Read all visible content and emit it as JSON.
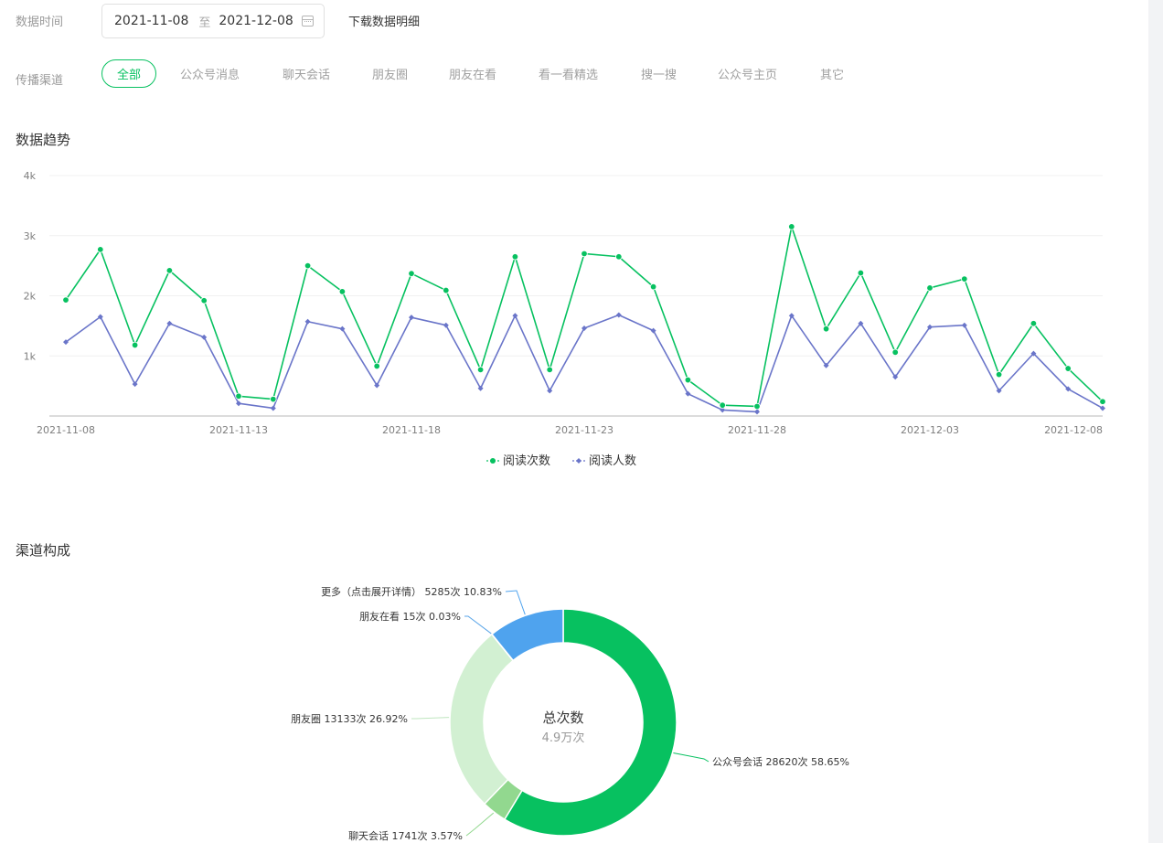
{
  "filters": {
    "date_label": "数据时间",
    "date_start": "2021-11-08",
    "date_sep": "至",
    "date_end": "2021-12-08",
    "download_label": "下载数据明细",
    "channel_label": "传播渠道",
    "channels": [
      "全部",
      "公众号消息",
      "聊天会话",
      "朋友圈",
      "朋友在看",
      "看一看精选",
      "搜一搜",
      "公众号主页",
      "其它"
    ],
    "active_channel": "全部"
  },
  "trend_title": "数据趋势",
  "composition_title": "渠道构成",
  "colors": {
    "accent": "#07c160",
    "series_reads": "#07c160",
    "series_readers": "#6a75c9",
    "pie_public_chat": "#07c160",
    "pie_chat": "#92d88f",
    "pie_moments": "#d2f0d2",
    "pie_looking": "#5aa5e8",
    "pie_more": "#4fa3ee"
  },
  "chart_data": [
    {
      "type": "line",
      "title": "",
      "xlabel": "",
      "ylabel": "",
      "ylim": [
        0,
        4000
      ],
      "yticks": [
        1000,
        2000,
        3000,
        4000
      ],
      "ytick_labels": [
        "1k",
        "2k",
        "3k",
        "4k"
      ],
      "x": [
        "2021-11-08",
        "2021-11-09",
        "2021-11-10",
        "2021-11-11",
        "2021-11-12",
        "2021-11-13",
        "2021-11-14",
        "2021-11-15",
        "2021-11-16",
        "2021-11-17",
        "2021-11-18",
        "2021-11-19",
        "2021-11-20",
        "2021-11-21",
        "2021-11-22",
        "2021-11-23",
        "2021-11-24",
        "2021-11-25",
        "2021-11-26",
        "2021-11-27",
        "2021-11-28",
        "2021-11-29",
        "2021-11-30",
        "2021-12-01",
        "2021-12-02",
        "2021-12-03",
        "2021-12-04",
        "2021-12-05",
        "2021-12-06",
        "2021-12-07",
        "2021-12-08"
      ],
      "xtick_labels": [
        "2021-11-08",
        "2021-11-13",
        "2021-11-18",
        "2021-11-23",
        "2021-11-28",
        "2021-12-03",
        "2021-12-08"
      ],
      "grid": true,
      "legend": "bottom-center",
      "series": [
        {
          "name": "阅读次数",
          "marker": "circle",
          "values": [
            1930,
            2770,
            1180,
            2420,
            1920,
            330,
            280,
            2500,
            2070,
            830,
            2370,
            2090,
            770,
            2650,
            770,
            2700,
            2650,
            2150,
            600,
            180,
            160,
            3150,
            1450,
            2380,
            1060,
            2130,
            2280,
            690,
            1540,
            790,
            240
          ]
        },
        {
          "name": "阅读人数",
          "marker": "diamond",
          "values": [
            1230,
            1650,
            530,
            1540,
            1310,
            210,
            130,
            1570,
            1450,
            510,
            1640,
            1510,
            460,
            1670,
            420,
            1460,
            1680,
            1420,
            370,
            100,
            70,
            1670,
            840,
            1540,
            650,
            1480,
            1510,
            420,
            1040,
            450,
            130
          ]
        }
      ]
    },
    {
      "type": "pie",
      "title": "",
      "center_title": "总次数",
      "center_value": "4.9万次",
      "slices": [
        {
          "name": "公众号会话",
          "count": 28620,
          "percent": 58.65,
          "label": "公众号会话 28620次 58.65%"
        },
        {
          "name": "聊天会话",
          "count": 1741,
          "percent": 3.57,
          "label": "聊天会话 1741次 3.57%"
        },
        {
          "name": "朋友圈",
          "count": 13133,
          "percent": 26.92,
          "label": "朋友圈 13133次 26.92%"
        },
        {
          "name": "朋友在看",
          "count": 15,
          "percent": 0.03,
          "label": "朋友在看 15次 0.03%"
        },
        {
          "name": "更多（点击展开详情）",
          "count": 5285,
          "percent": 10.83,
          "label": "更多（点击展开详情） 5285次 10.83%"
        }
      ]
    }
  ]
}
